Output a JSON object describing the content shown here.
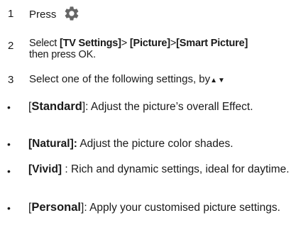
{
  "steps": [
    {
      "num": "1",
      "text": "Press",
      "icon": "gear-icon",
      "icon_color": "#666666"
    },
    {
      "num": "2",
      "pre": "Select ",
      "b1": "[TV Settings]",
      "sep1": "> ",
      "b2": "[Picture]",
      "sep2": ">",
      "b3": "[Smart Picture]",
      "post": "then press OK."
    },
    {
      "num": "3",
      "text": "Select one of the following settings, by",
      "arrows": "▲▼"
    }
  ],
  "bullets": [
    {
      "marker": "•",
      "open": "[",
      "term": "Standard",
      "close": "]",
      "desc": ": Adjust the picture’s overall Effect."
    },
    {
      "marker": "•",
      "term": "[Natural]:",
      "desc": " Adjust the picture color shades."
    },
    {
      "marker": "•",
      "term": "[Vivid]",
      "desc": "  : Rich and dynamic settings, ideal for daytime."
    },
    {
      "marker": "•",
      "open": "[",
      "term": "Personal",
      "close": "]",
      "desc": ": Apply your customised  picture settings."
    }
  ]
}
